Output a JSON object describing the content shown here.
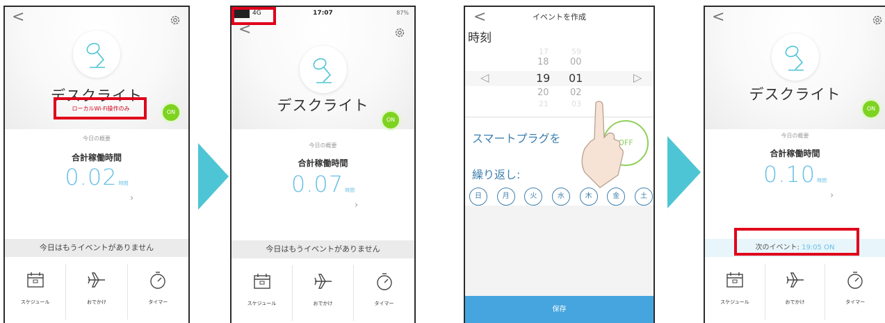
{
  "common": {
    "device_name": "デスクライト",
    "on_label": "ON",
    "today_overview": "今日の概要",
    "total_runtime_label": "合計稼働時間",
    "unit_hours": "時間",
    "no_event_text": "今日はもうイベントがありません",
    "tools": [
      {
        "label": "スケジュール",
        "icon": "calendar-icon"
      },
      {
        "label": "おでかけ",
        "icon": "airplane-icon"
      },
      {
        "label": "タイマー",
        "icon": "stopwatch-icon"
      }
    ],
    "accent_color": "#6ac0e8",
    "on_color": "#7ed321",
    "highlight_color": "#e0001b",
    "arrow_color": "#4ec5d4"
  },
  "screen1": {
    "local_wifi_note": "ローカルWi-Fi操作のみ",
    "runtime_value": "0.02"
  },
  "screen2": {
    "status_carrier": "4G",
    "status_time": "17:07",
    "status_battery": "87%",
    "runtime_value": "0.07"
  },
  "screen3": {
    "header_title": "イベントを作成",
    "time_label": "時刻",
    "hours": [
      "17",
      "18",
      "19",
      "20",
      "21"
    ],
    "minutes": [
      "59",
      "00",
      "01",
      "02",
      "03"
    ],
    "selected_hour": "19",
    "selected_minute": "01",
    "plug_label": "スマートプラグを",
    "off_label": "OFF",
    "repeat_label": "繰り返し:",
    "days": [
      "日",
      "月",
      "火",
      "水",
      "木",
      "金",
      "土"
    ],
    "save_label": "保存"
  },
  "screen4": {
    "runtime_value": "0.10",
    "next_event_label": "次のイベント: ",
    "next_event_time": "19:05 ON"
  }
}
